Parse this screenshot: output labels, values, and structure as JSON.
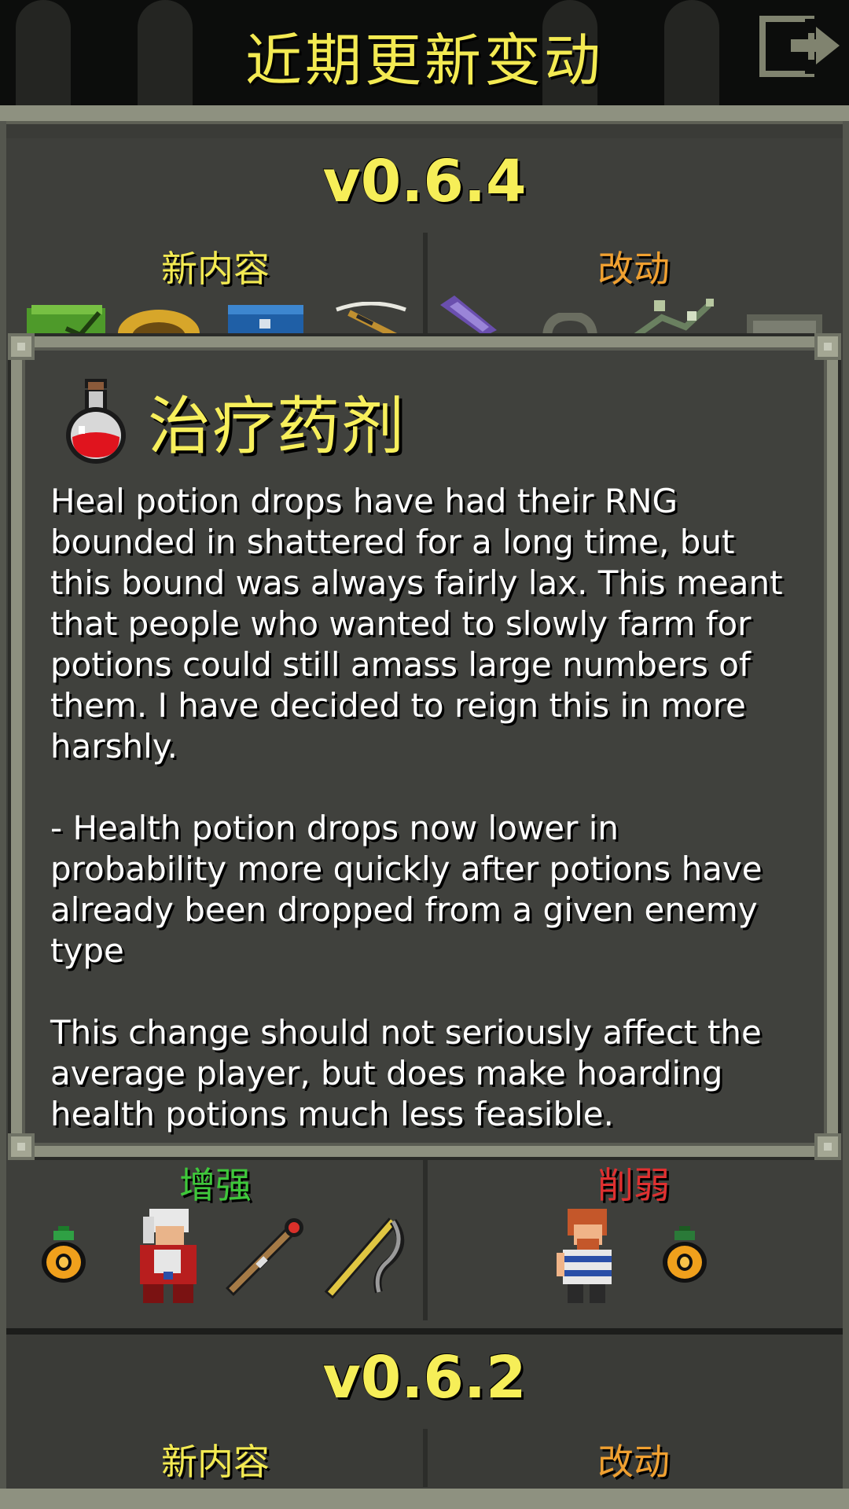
{
  "header": {
    "title": "近期更新变动"
  },
  "sections": [
    {
      "version": "v0.6.4",
      "left_label": "新内容",
      "right_label": "改动",
      "lower_left_label": "增强",
      "lower_right_label": "削弱"
    },
    {
      "version": "v0.6.2",
      "left_label": "新内容",
      "right_label": "改动"
    }
  ],
  "popup": {
    "title": "治疗药剂",
    "icon": "healing-potion-icon",
    "paragraphs": [
      "Heal potion drops have had their RNG bounded in shattered for a long time, but this bound was always fairly lax. This meant that people who wanted to slowly farm for potions could still amass large numbers of them. I have decided to reign this in more harshly.",
      "- Health potion drops now lower in probability more quickly after potions have already been dropped from a given enemy type",
      "This change should not seriously affect the average player, but does make hoarding health potions much less feasible."
    ]
  },
  "colors": {
    "title_yellow": "#f3ea52",
    "new_content": "#f3ea52",
    "changes": "#f0a030",
    "buffs": "#3ec83a",
    "nerfs": "#e03030"
  }
}
